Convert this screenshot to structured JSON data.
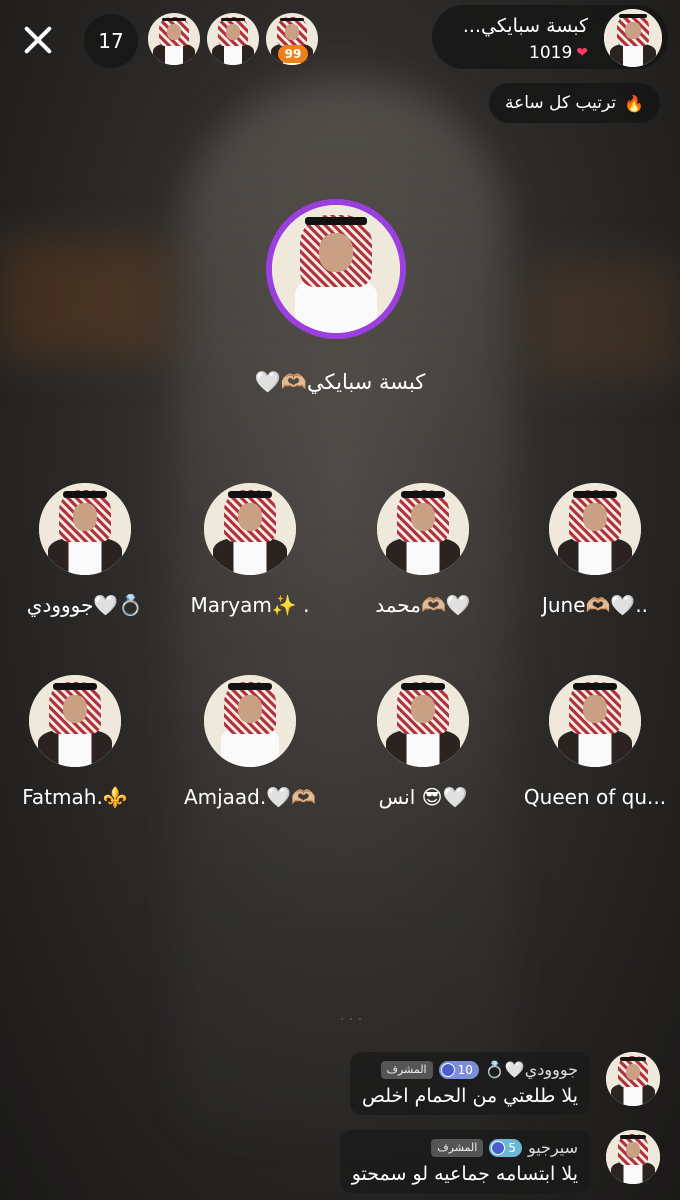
{
  "header": {
    "viewer_count": "17",
    "top_badge": "99",
    "host_name": "كبسة سبايكي...",
    "host_likes": "1019",
    "ranking_label": "ترتيب كل ساعة"
  },
  "main_host": {
    "name": "كبسة سبايكي🫶🏼🤍"
  },
  "seats": [
    {
      "name": "جووودي🤍💍"
    },
    {
      "name": "Maryam✨ ."
    },
    {
      "name": "محمد🫶🏼🤍"
    },
    {
      "name": "June🫶🏼🤍.."
    },
    {
      "name": "Fatmah.⚜️"
    },
    {
      "name": "Amjaad.🤍🫶🏼"
    },
    {
      "name": "انس 😎🤍"
    },
    {
      "name": "Queen of qu..."
    }
  ],
  "chat": [
    {
      "user": "جووودي🤍💍",
      "level": "10",
      "role": "المشرف",
      "text": "يلا طلعتي من الحمام اخلص"
    },
    {
      "user": "سيرجيو",
      "level": "5",
      "role": "المشرف",
      "text": "يلا ابتسامه جماعيه لو سمحتو"
    }
  ],
  "colors": {
    "host_ring": "#9b3fe0",
    "badge": "#f0811a",
    "heart": "#ff3b5c"
  },
  "icons": {
    "close": "close-icon",
    "heart": "heart-icon",
    "fire": "fire-icon"
  }
}
